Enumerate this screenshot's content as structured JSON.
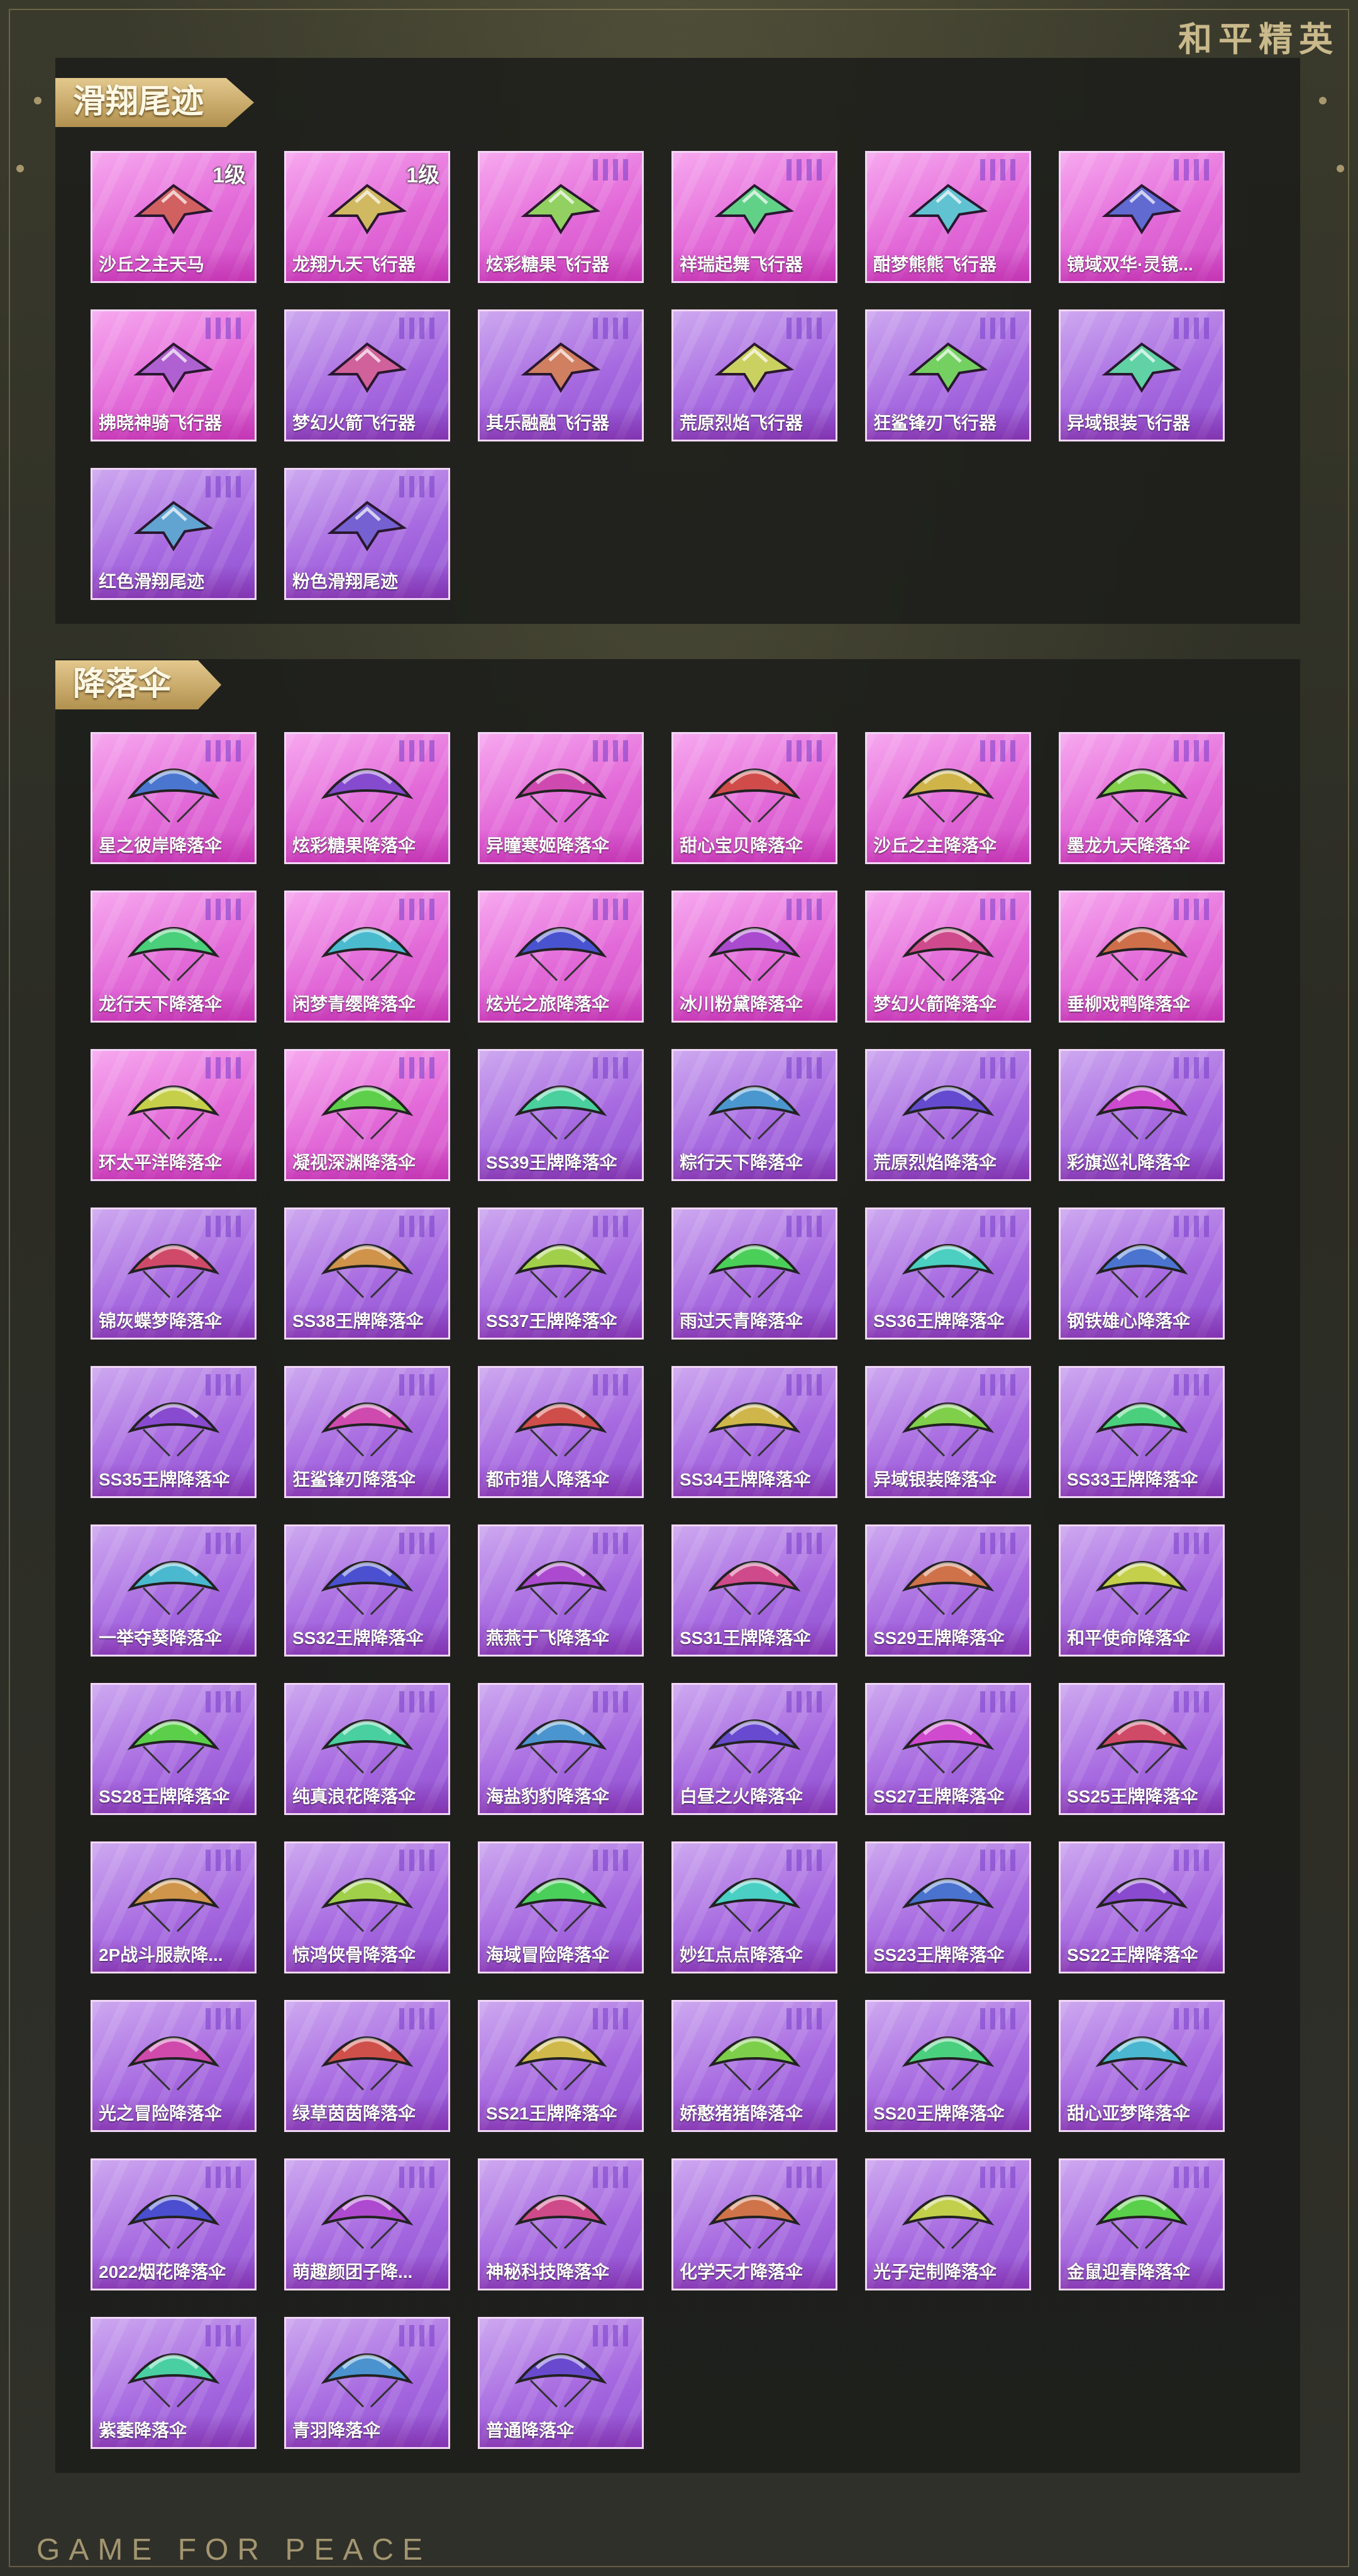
{
  "brand": {
    "top": "和平精英",
    "bottom": "GAME FOR PEACE"
  },
  "sections": [
    {
      "title": "滑翔尾迹",
      "items": [
        {
          "label": "沙丘之主天马",
          "tier": "pink",
          "level": "1级"
        },
        {
          "label": "龙翔九天飞行器",
          "tier": "pink",
          "level": "1级"
        },
        {
          "label": "炫彩糖果飞行器",
          "tier": "pink"
        },
        {
          "label": "祥瑞起舞飞行器",
          "tier": "pink"
        },
        {
          "label": "酣梦熊熊飞行器",
          "tier": "pink"
        },
        {
          "label": "镜域双华·灵镜...",
          "tier": "pink"
        },
        {
          "label": "拂晓神骑飞行器",
          "tier": "pink"
        },
        {
          "label": "梦幻火箭飞行器",
          "tier": "purple"
        },
        {
          "label": "其乐融融飞行器",
          "tier": "purple"
        },
        {
          "label": "荒原烈焰飞行器",
          "tier": "purple"
        },
        {
          "label": "狂鲨锋刃飞行器",
          "tier": "purple"
        },
        {
          "label": "异域银装飞行器",
          "tier": "purple"
        },
        {
          "label": "红色滑翔尾迹",
          "tier": "purple"
        },
        {
          "label": "粉色滑翔尾迹",
          "tier": "purple"
        }
      ]
    },
    {
      "title": "降落伞",
      "items": [
        {
          "label": "星之彼岸降落伞",
          "tier": "pink"
        },
        {
          "label": "炫彩糖果降落伞",
          "tier": "pink"
        },
        {
          "label": "异瞳寒姬降落伞",
          "tier": "pink"
        },
        {
          "label": "甜心宝贝降落伞",
          "tier": "pink"
        },
        {
          "label": "沙丘之主降落伞",
          "tier": "pink"
        },
        {
          "label": "墨龙九天降落伞",
          "tier": "pink"
        },
        {
          "label": "龙行天下降落伞",
          "tier": "pink"
        },
        {
          "label": "闲梦青缨降落伞",
          "tier": "pink"
        },
        {
          "label": "炫光之旅降落伞",
          "tier": "pink"
        },
        {
          "label": "冰川粉黛降落伞",
          "tier": "pink"
        },
        {
          "label": "梦幻火箭降落伞",
          "tier": "pink"
        },
        {
          "label": "垂柳戏鸭降落伞",
          "tier": "pink"
        },
        {
          "label": "环太平洋降落伞",
          "tier": "pink"
        },
        {
          "label": "凝视深渊降落伞",
          "tier": "pink"
        },
        {
          "label": "SS39王牌降落伞",
          "tier": "purple"
        },
        {
          "label": "粽行天下降落伞",
          "tier": "purple"
        },
        {
          "label": "荒原烈焰降落伞",
          "tier": "purple"
        },
        {
          "label": "彩旗巡礼降落伞",
          "tier": "purple"
        },
        {
          "label": "锦灰蝶梦降落伞",
          "tier": "purple"
        },
        {
          "label": "SS38王牌降落伞",
          "tier": "purple"
        },
        {
          "label": "SS37王牌降落伞",
          "tier": "purple"
        },
        {
          "label": "雨过天青降落伞",
          "tier": "purple"
        },
        {
          "label": "SS36王牌降落伞",
          "tier": "purple"
        },
        {
          "label": "钢铁雄心降落伞",
          "tier": "purple"
        },
        {
          "label": "SS35王牌降落伞",
          "tier": "purple"
        },
        {
          "label": "狂鲨锋刃降落伞",
          "tier": "purple"
        },
        {
          "label": "都市猎人降落伞",
          "tier": "purple"
        },
        {
          "label": "SS34王牌降落伞",
          "tier": "purple"
        },
        {
          "label": "异域银装降落伞",
          "tier": "purple"
        },
        {
          "label": "SS33王牌降落伞",
          "tier": "purple"
        },
        {
          "label": "一举夺葵降落伞",
          "tier": "purple"
        },
        {
          "label": "SS32王牌降落伞",
          "tier": "purple"
        },
        {
          "label": "燕燕于飞降落伞",
          "tier": "purple"
        },
        {
          "label": "SS31王牌降落伞",
          "tier": "purple"
        },
        {
          "label": "SS29王牌降落伞",
          "tier": "purple"
        },
        {
          "label": "和平使命降落伞",
          "tier": "purple"
        },
        {
          "label": "SS28王牌降落伞",
          "tier": "purple"
        },
        {
          "label": "纯真浪花降落伞",
          "tier": "purple"
        },
        {
          "label": "海盐豹豹降落伞",
          "tier": "purple"
        },
        {
          "label": "白昼之火降落伞",
          "tier": "purple"
        },
        {
          "label": "SS27王牌降落伞",
          "tier": "purple"
        },
        {
          "label": "SS25王牌降落伞",
          "tier": "purple"
        },
        {
          "label": "2P战斗服款降...",
          "tier": "purple"
        },
        {
          "label": "惊鸿侠骨降落伞",
          "tier": "purple"
        },
        {
          "label": "海域冒险降落伞",
          "tier": "purple"
        },
        {
          "label": "妙红点点降落伞",
          "tier": "purple"
        },
        {
          "label": "SS23王牌降落伞",
          "tier": "purple"
        },
        {
          "label": "SS22王牌降落伞",
          "tier": "purple"
        },
        {
          "label": "光之冒险降落伞",
          "tier": "purple"
        },
        {
          "label": "绿草茵茵降落伞",
          "tier": "purple"
        },
        {
          "label": "SS21王牌降落伞",
          "tier": "purple"
        },
        {
          "label": "娇憨猪猪降落伞",
          "tier": "purple"
        },
        {
          "label": "SS20王牌降落伞",
          "tier": "purple"
        },
        {
          "label": "甜心亚梦降落伞",
          "tier": "purple"
        },
        {
          "label": "2022烟花降落伞",
          "tier": "purple"
        },
        {
          "label": "萌趣颜团子降...",
          "tier": "purple"
        },
        {
          "label": "神秘科技降落伞",
          "tier": "purple"
        },
        {
          "label": "化学天才降落伞",
          "tier": "purple"
        },
        {
          "label": "光子定制降落伞",
          "tier": "purple"
        },
        {
          "label": "金鼠迎春降落伞",
          "tier": "purple"
        },
        {
          "label": "紫萎降落伞",
          "tier": "purple"
        },
        {
          "label": "青羽降落伞",
          "tier": "purple"
        },
        {
          "label": "普通降落伞",
          "tier": "purple"
        }
      ]
    }
  ],
  "colors": {
    "pink_tier": "#e269d8",
    "purple_tier": "#a76ae0",
    "title_gold": "#c9a463",
    "panel_bg": "#1c1e1a"
  },
  "icons": {
    "glider": "glider-icon",
    "parachute": "parachute-icon"
  }
}
